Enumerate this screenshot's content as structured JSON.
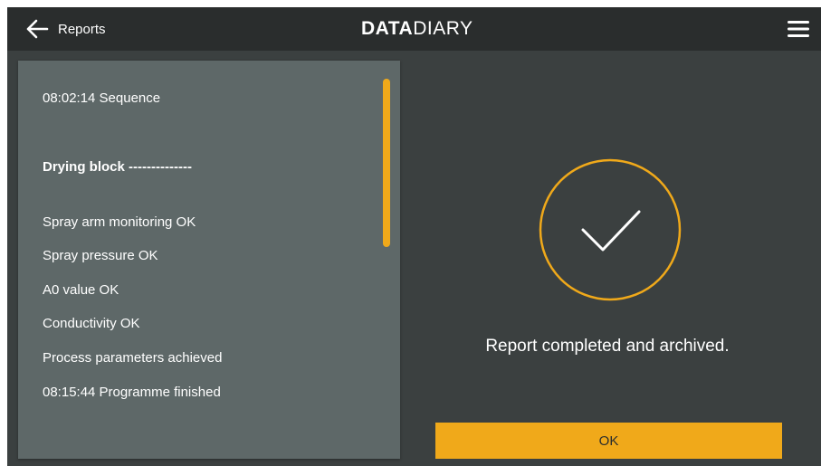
{
  "header": {
    "back_label": "Reports",
    "brand_bold": "DATA",
    "brand_light": "DIARY",
    "back_icon": "arrow-left-icon",
    "menu_icon": "hamburger-menu-icon"
  },
  "report_log": {
    "lines": [
      {
        "text": "08:02:14 Sequence",
        "bold": false
      },
      {
        "text": "Drying block --------------",
        "bold": true
      },
      {
        "text": "Spray arm monitoring OK",
        "bold": false
      },
      {
        "text": "Spray pressure OK",
        "bold": false
      },
      {
        "text": "A0 value OK",
        "bold": false
      },
      {
        "text": "Conductivity OK",
        "bold": false
      },
      {
        "text": "Process parameters achieved",
        "bold": false
      },
      {
        "text": "08:15:44 Programme finished",
        "bold": false
      }
    ]
  },
  "status": {
    "icon": "checkmark-circle-icon",
    "message": "Report completed and archived."
  },
  "actions": {
    "ok_label": "OK"
  },
  "colors": {
    "accent": "#f0a91a",
    "topbar": "#2a2d2d",
    "background": "#3b4040",
    "panel": "#5e6868",
    "text": "#ffffff"
  }
}
